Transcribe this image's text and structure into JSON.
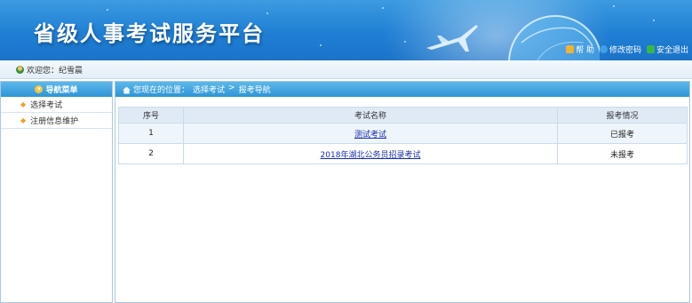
{
  "header": {
    "site_title": "省级人事考试服务平台",
    "links": [
      {
        "label": "帮 助",
        "icon": "help-icon",
        "color": "#f0b232"
      },
      {
        "label": "修改密码",
        "icon": "password-icon",
        "color": "#3fa0e6"
      },
      {
        "label": "安全退出",
        "icon": "logout-icon",
        "color": "#39b54a"
      }
    ]
  },
  "welcome": {
    "text": "欢迎您：纪雪晨"
  },
  "sidebar": {
    "heading": "导航菜单",
    "items": [
      {
        "label": "选择考试"
      },
      {
        "label": "注册信息维护"
      }
    ]
  },
  "breadcrumb": {
    "prefix": "您现在的位置：",
    "path": [
      "选择考试",
      ">",
      "报考导航"
    ]
  },
  "table": {
    "columns": [
      "序号",
      "考试名称",
      "报考情况"
    ],
    "rows": [
      {
        "no": "1",
        "name": "测试考试",
        "status": "已报考"
      },
      {
        "no": "2",
        "name": "2018年湖北公务员招录考试",
        "status": "未报考"
      }
    ]
  },
  "colors": {
    "header_blue": "#1f7fd4",
    "bar_blue": "#2d95d6",
    "link_blue": "#1a2fb0"
  }
}
